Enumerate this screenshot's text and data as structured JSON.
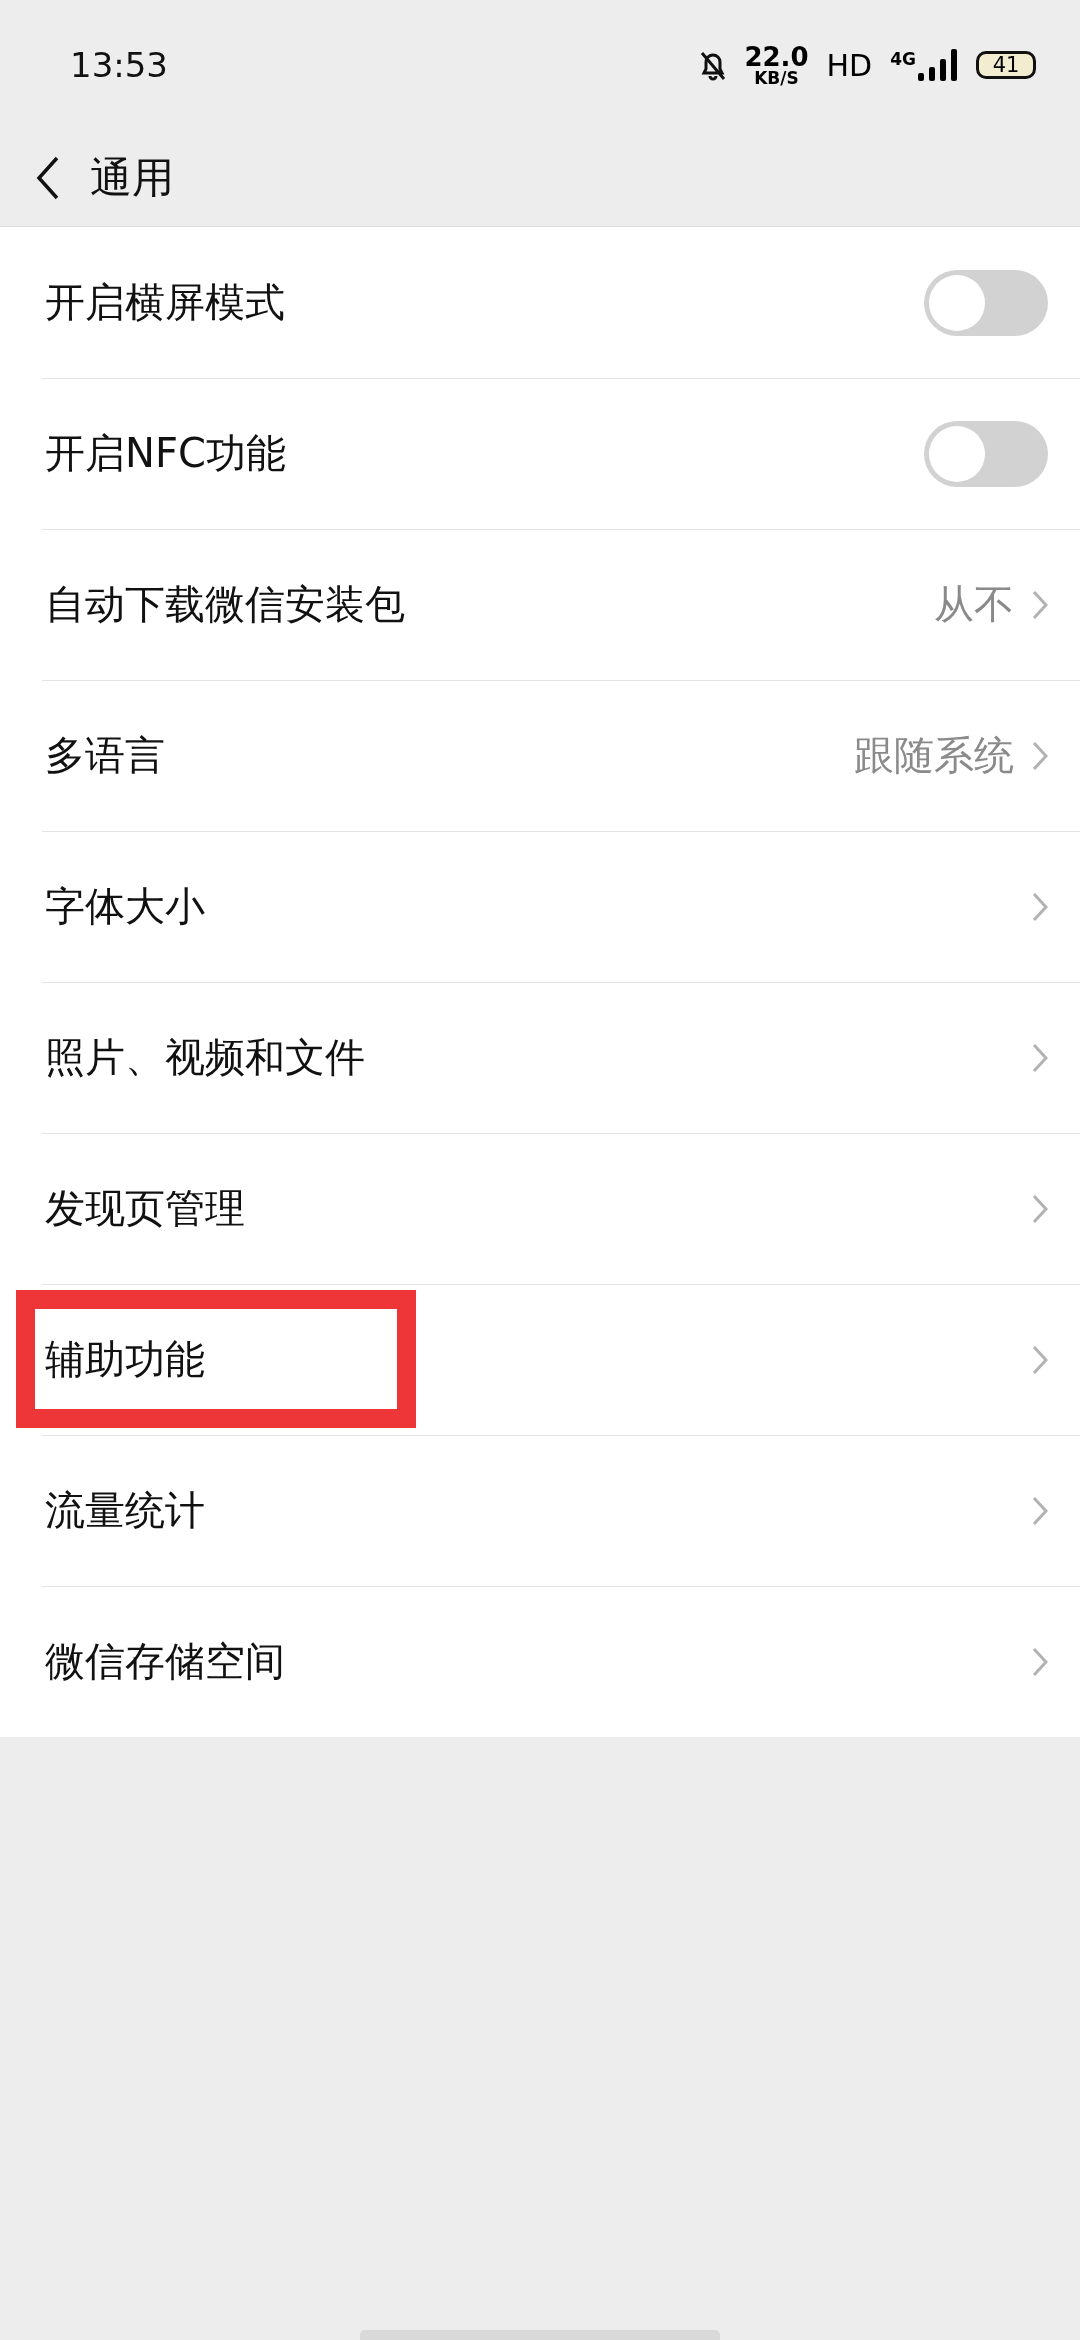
{
  "status_bar": {
    "time": "13:53",
    "speed": "22.0",
    "speed_unit": "KB/S",
    "hd": "HD",
    "network": "4G",
    "battery": "41"
  },
  "header": {
    "title": "通用"
  },
  "items": [
    {
      "kind": "toggle",
      "label": "开启横屏模式",
      "on": false,
      "highlighted": false
    },
    {
      "kind": "toggle",
      "label": "开启NFC功能",
      "on": false,
      "highlighted": false
    },
    {
      "kind": "link",
      "label": "自动下载微信安装包",
      "value": "从不",
      "highlighted": false
    },
    {
      "kind": "link",
      "label": "多语言",
      "value": "跟随系统",
      "highlighted": false
    },
    {
      "kind": "link",
      "label": "字体大小",
      "highlighted": false
    },
    {
      "kind": "link",
      "label": "照片、视频和文件",
      "highlighted": false
    },
    {
      "kind": "link",
      "label": "发现页管理",
      "highlighted": false
    },
    {
      "kind": "link",
      "label": "辅助功能",
      "highlighted": true
    },
    {
      "kind": "link",
      "label": "流量统计",
      "highlighted": false
    },
    {
      "kind": "link",
      "label": "微信存储空间",
      "highlighted": false
    }
  ]
}
